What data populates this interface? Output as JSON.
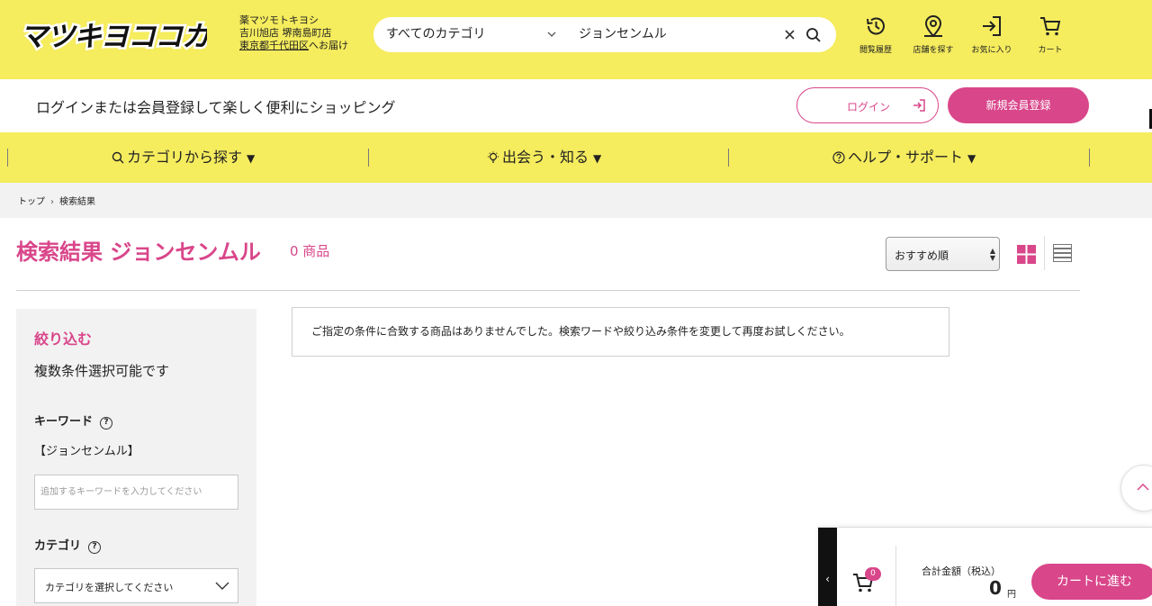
{
  "header": {
    "logo_text": "マツキヨココカラ",
    "store": {
      "line1": "薬マツモトキヨシ",
      "line2": "吉川旭店 堺南島町店",
      "address": "東京都千代田区",
      "deliver_suffix": "へお届け"
    },
    "search": {
      "category": "すべてのカテゴリ",
      "query": "ジョンセンムル"
    },
    "icons": [
      {
        "label": "閲覧履歴",
        "icon": "history-icon"
      },
      {
        "label": "店舗を探す",
        "icon": "store-pin-icon"
      },
      {
        "label": "お気に入り",
        "icon": "favorite-login-icon"
      },
      {
        "label": "カート",
        "icon": "cart-icon"
      }
    ]
  },
  "login_bar": {
    "message": "ログインまたは会員登録して楽しく便利にショッピング",
    "login_label": "ログイン",
    "register_label": "新規会員登録"
  },
  "nav": {
    "items": [
      {
        "label": "カテゴリから探す",
        "icon": "search-icon"
      },
      {
        "label": "出会う・知る",
        "icon": "bulb-icon"
      },
      {
        "label": "ヘルプ・サポート",
        "icon": "help-icon"
      }
    ]
  },
  "breadcrumb": [
    "トップ",
    "検索結果"
  ],
  "results": {
    "title": "検索結果 ジョンセンムル",
    "count": "0 商品",
    "sort": "おすすめ順",
    "message": "ご指定の条件に合致する商品はありませんでした。検索ワードや絞り込み条件を変更して再度お試しください。"
  },
  "sidebar": {
    "title": "絞り込む",
    "subtitle": "複数条件選択可能です",
    "keyword_label": "キーワード",
    "keyword_value": "【ジョンセンムル】",
    "keyword_placeholder": "追加するキーワードを入力してください",
    "category_label": "カテゴリ",
    "category_placeholder": "カテゴリを選択してください"
  },
  "cart_bar": {
    "badge": "0",
    "total_label": "合計金額（税込）",
    "total_value": "0",
    "total_unit": "円",
    "checkout_label": "カートに進む"
  },
  "colors": {
    "brand_yellow": "#f5ec5e",
    "accent_pink": "#d9468a"
  }
}
